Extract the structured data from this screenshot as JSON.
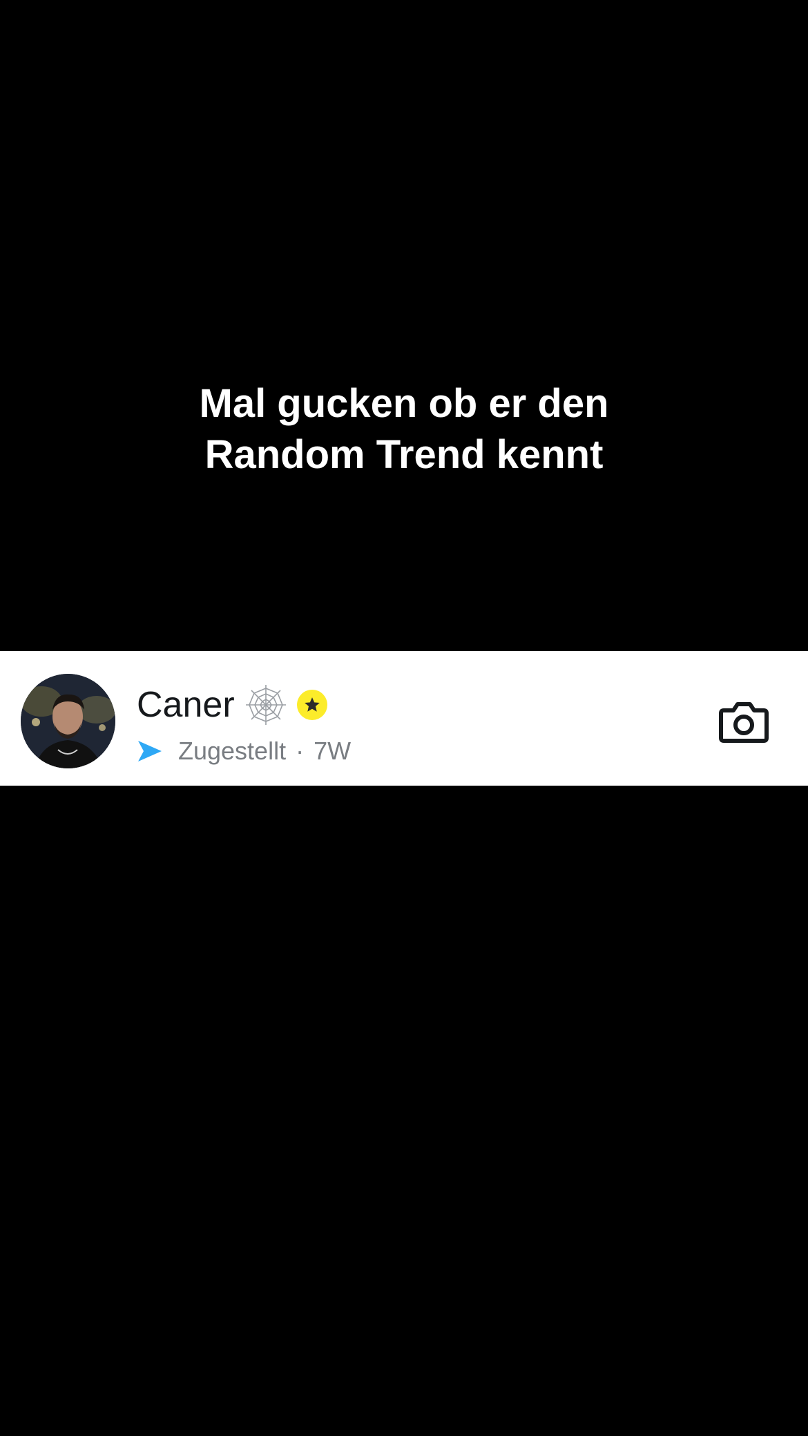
{
  "caption": {
    "line1": "Mal gucken ob er den",
    "line2": "Random Trend kennt"
  },
  "chat": {
    "name": "Caner",
    "status": "Zugestellt",
    "separator": "·",
    "age": "7W",
    "icons": {
      "avatar": "profile-photo",
      "web": "spider-web-icon",
      "badge": "star-badge-icon",
      "sent": "sent-arrow-icon",
      "camera": "camera-icon"
    },
    "colors": {
      "sent_arrow": "#2ea8f5",
      "badge_fill": "#fcec2a",
      "status_text": "#797d82"
    }
  }
}
